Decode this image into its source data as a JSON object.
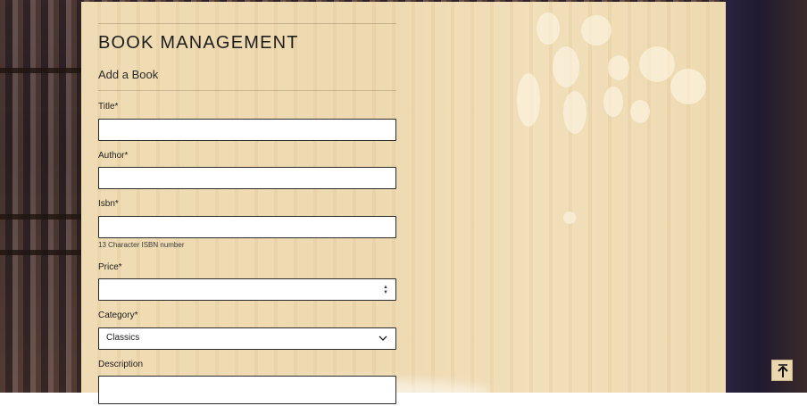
{
  "header": {
    "title": "BOOK MANAGEMENT",
    "subtitle": "Add a Book"
  },
  "form": {
    "title_label": "Title*",
    "title_value": "",
    "author_label": "Author*",
    "author_value": "",
    "isbn_label": "Isbn*",
    "isbn_value": "",
    "isbn_help": "13 Character ISBN number",
    "price_label": "Price*",
    "price_value": "",
    "category_label": "Category*",
    "category_selected": "Classics",
    "description_label": "Description",
    "description_value": ""
  },
  "controls": {
    "scroll_top_icon": "arrow-up-to-line-icon",
    "category_dropdown_icon": "chevron-down-icon",
    "price_spinner_icon": "number-spinner-icon"
  },
  "colors": {
    "panel": "#f0dcb4",
    "text": "#1e1e1e",
    "input_border": "#2a2a2a"
  }
}
